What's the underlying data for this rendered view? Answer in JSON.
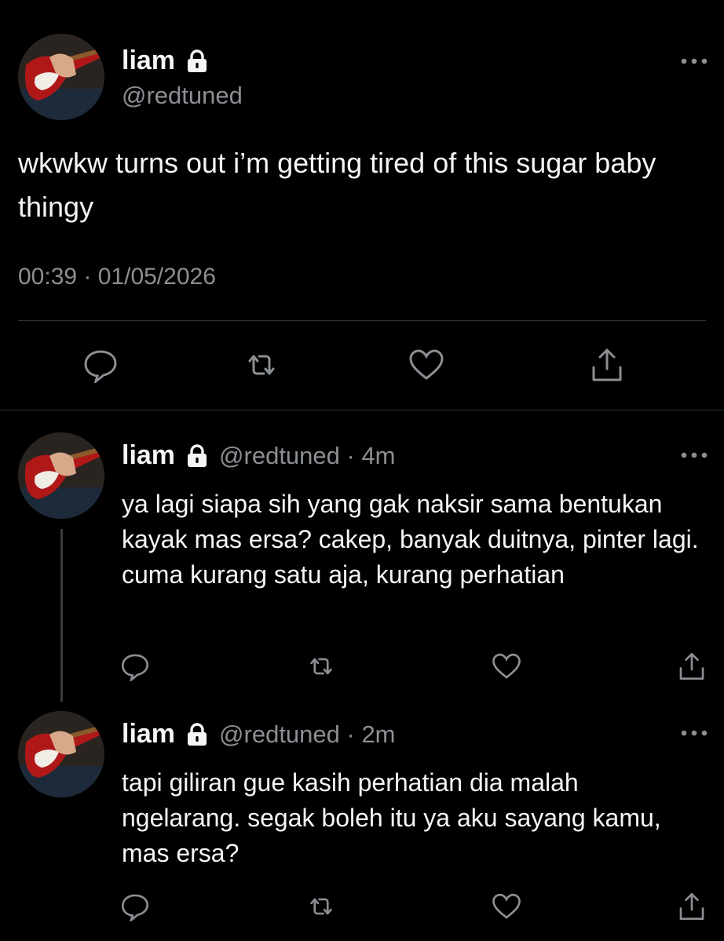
{
  "main_tweet": {
    "name": "liam",
    "handle": "@redtuned",
    "text": "wkwkw turns out i’m getting tired of this sugar baby thingy",
    "timestamp": "00:39 · 01/05/2026"
  },
  "replies": [
    {
      "name": "liam",
      "meta": "@redtuned · 4m",
      "text": "ya lagi siapa sih yang gak naksir sama bentukan kayak mas ersa? cakep, banyak duitnya, pinter lagi. cuma kurang satu aja, kurang perhatian"
    },
    {
      "name": "liam",
      "meta": "@redtuned · 2m",
      "text": "tapi giliran gue kasih perhatian dia malah ngelarang. segak boleh itu ya aku sayang kamu, mas ersa?"
    }
  ],
  "icons": {
    "more": "more-icon",
    "lock": "lock-icon",
    "reply": "reply-icon",
    "retweet": "retweet-icon",
    "like": "like-icon",
    "share": "share-icon"
  },
  "colors": {
    "background": "#000000",
    "text": "#f5f5f5",
    "secondary": "#8b8f94",
    "divider": "#2f3336"
  }
}
